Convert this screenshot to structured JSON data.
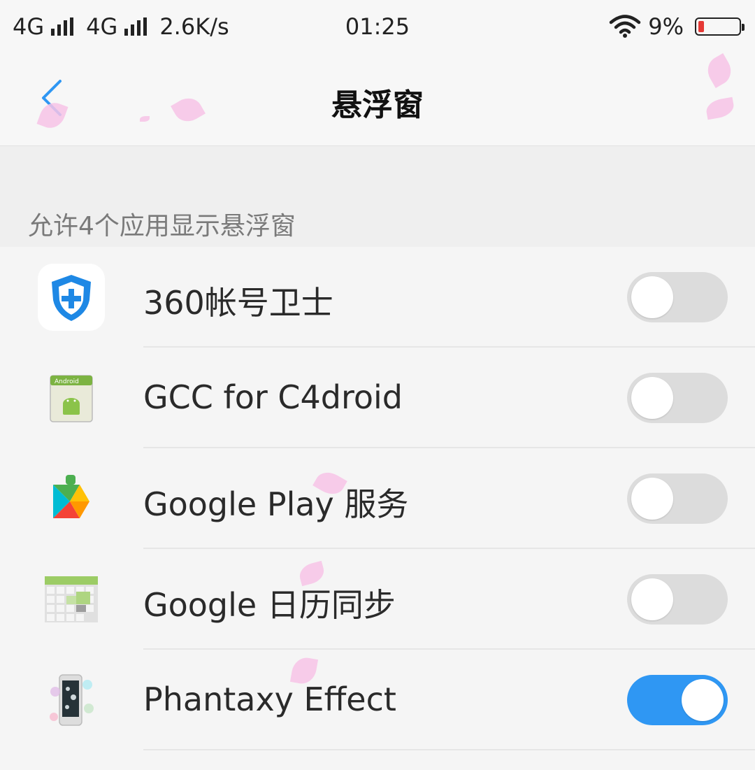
{
  "status_bar": {
    "net1": "4G",
    "net2": "4G",
    "speed": "2.6K/s",
    "time": "01:25",
    "battery_percent_text": "9%",
    "battery_level": 0.09,
    "battery_color": "#e53935"
  },
  "header": {
    "title": "悬浮窗",
    "back_icon": "chevron-left-icon"
  },
  "section": {
    "title": "允许4个应用显示悬浮窗"
  },
  "apps": [
    {
      "name": "360帐号卫士",
      "icon": "360-shield-icon",
      "enabled": false
    },
    {
      "name": "GCC for C4droid",
      "icon": "android-app-icon",
      "enabled": false
    },
    {
      "name": "Google Play 服务",
      "icon": "google-play-services-icon",
      "enabled": false
    },
    {
      "name": "Google 日历同步",
      "icon": "calendar-sync-icon",
      "enabled": false
    },
    {
      "name": "Phantaxy Effect",
      "icon": "phantaxy-phone-icon",
      "enabled": true
    }
  ],
  "colors": {
    "accent": "#2f97f3",
    "toggle_off": "#dcdcdc",
    "background": "#f5f5f5"
  }
}
